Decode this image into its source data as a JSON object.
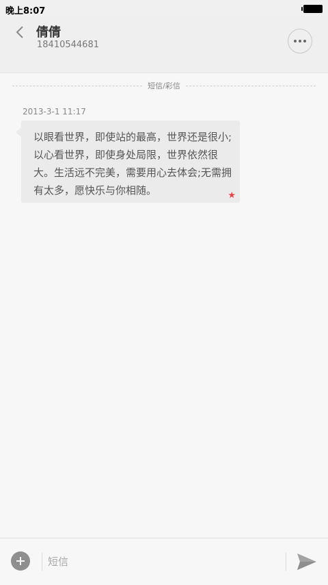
{
  "status_bar": {
    "time": "晚上8:07"
  },
  "header": {
    "contact_name": "倩倩",
    "contact_number": "18410544681",
    "back_icon": "chevron-left-icon",
    "more_icon": "more-horizontal-icon"
  },
  "conversation": {
    "divider_label": "短信/彩信",
    "messages": [
      {
        "time": "2013-3-1 11:17",
        "text": "以眼看世界，即使站的最高，世界还是很小;以心看世界，即使身处局限，世界依然很大。生活远不完美，需要用心去体会;无需拥有太多，愿快乐与你相随。",
        "starred": true,
        "star_icon": "star-icon"
      }
    ]
  },
  "composer": {
    "placeholder": "短信",
    "attach_icon": "plus-circle-icon",
    "send_icon": "send-icon"
  },
  "colors": {
    "star": "#e64545",
    "bubble": "#ebebeb",
    "header_bg": "#efefef"
  }
}
